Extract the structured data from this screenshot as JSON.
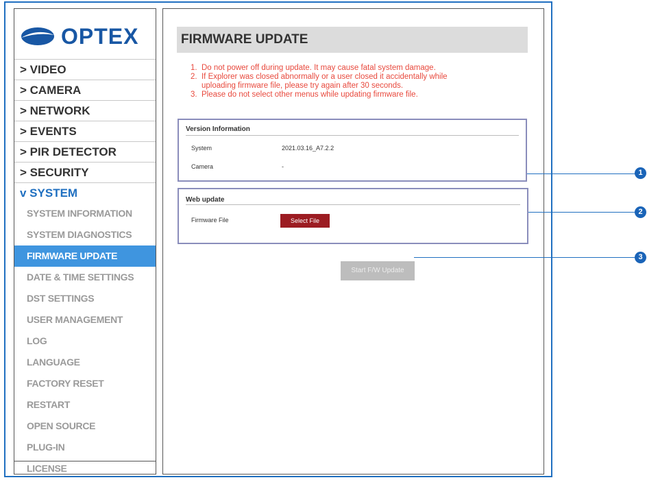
{
  "brand": {
    "logo_text": "OPTEX",
    "logo_icon": "optex-swoosh-icon"
  },
  "sidebar": {
    "menu": [
      {
        "label": "> VIDEO"
      },
      {
        "label": "> CAMERA"
      },
      {
        "label": "> NETWORK"
      },
      {
        "label": "> EVENTS"
      },
      {
        "label": "> PIR DETECTOR"
      },
      {
        "label": "> SECURITY"
      },
      {
        "label": "v SYSTEM"
      }
    ],
    "system_sub": [
      "SYSTEM INFORMATION",
      "SYSTEM DIAGNOSTICS",
      "FIRMWARE UPDATE",
      "DATE & TIME SETTINGS",
      "DST SETTINGS",
      "USER MANAGEMENT",
      "LOG",
      "LANGUAGE",
      "FACTORY RESET",
      "RESTART",
      "OPEN SOURCE",
      "PLUG-IN",
      "LICENSE"
    ]
  },
  "main": {
    "title": "FIRMWARE UPDATE",
    "notes": [
      "1.  Do not power off during update. It may cause fatal system damage.",
      "2.  If Explorer was closed abnormally or a user closed it accidentally while",
      "     uploading firmware file, please try again after 30 seconds.",
      "3.  Please do not select other menus while updating firmware file."
    ],
    "version_info": {
      "title": "Version Information",
      "system_label": "System",
      "system_value": "2021.03.16_A7.2.2",
      "camera_label": "Camera",
      "camera_value": "-"
    },
    "web_update": {
      "title": "Web update",
      "firmware_label": "Firmware File",
      "select_button": "Select File"
    },
    "start_button": "Start F/W Update"
  },
  "callouts": [
    "1",
    "2",
    "3"
  ],
  "colors": {
    "accent": "#1f6fc0",
    "selected": "#3f95df",
    "warning": "#e8493d",
    "select_btn": "#9c1c22"
  }
}
